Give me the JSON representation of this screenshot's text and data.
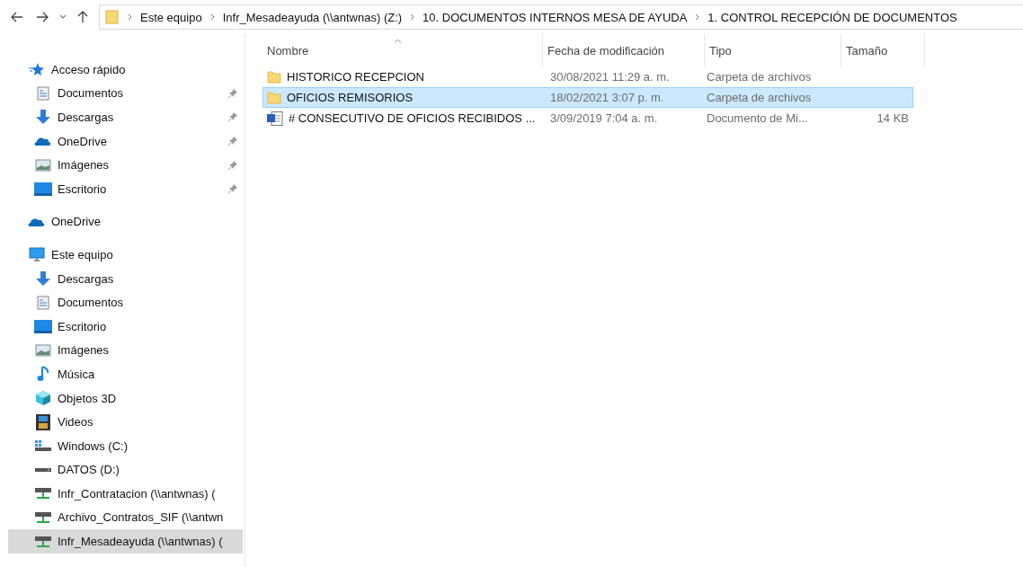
{
  "address_bar": {
    "crumbs": [
      "Este equipo",
      "Infr_Mesadeayuda (\\\\antwnas) (Z:)",
      "10. DOCUMENTOS INTERNOS MESA DE AYUDA",
      "1. CONTROL RECEPCIÓN DE DOCUMENTOS"
    ]
  },
  "sidebar": {
    "groups": [
      {
        "label": "Acceso rápido",
        "kind": "star",
        "selected": false,
        "children": [
          {
            "label": "Documentos",
            "kind": "documents",
            "pinned": true,
            "selected": false
          },
          {
            "label": "Descargas",
            "kind": "download",
            "pinned": true,
            "selected": false
          },
          {
            "label": "OneDrive",
            "kind": "cloud",
            "pinned": true,
            "selected": false
          },
          {
            "label": "Imágenes",
            "kind": "pictures",
            "pinned": true,
            "selected": false
          },
          {
            "label": "Escritorio",
            "kind": "desktop",
            "pinned": true,
            "selected": false
          }
        ]
      },
      {
        "label": "OneDrive",
        "kind": "cloud",
        "selected": false
      },
      {
        "label": "Este equipo",
        "kind": "pc",
        "selected": false,
        "children": [
          {
            "label": "Descargas",
            "kind": "download",
            "pinned": false,
            "selected": false
          },
          {
            "label": "Documentos",
            "kind": "documents",
            "pinned": false,
            "selected": false
          },
          {
            "label": "Escritorio",
            "kind": "desktop",
            "pinned": false,
            "selected": false
          },
          {
            "label": "Imágenes",
            "kind": "pictures",
            "pinned": false,
            "selected": false
          },
          {
            "label": "Música",
            "kind": "music",
            "pinned": false,
            "selected": false
          },
          {
            "label": "Objetos 3D",
            "kind": "cube",
            "pinned": false,
            "selected": false
          },
          {
            "label": "Videos",
            "kind": "video",
            "pinned": false,
            "selected": false
          },
          {
            "label": "Windows (C:)",
            "kind": "windows-drive",
            "pinned": false,
            "selected": false
          },
          {
            "label": "DATOS (D:)",
            "kind": "drive",
            "pinned": false,
            "selected": false
          },
          {
            "label": "Infr_Contratacion (\\\\antwnas) (",
            "kind": "network-drive",
            "pinned": false,
            "selected": false
          },
          {
            "label": "Archivo_Contratos_SIF (\\\\antwn",
            "kind": "network-drive",
            "pinned": false,
            "selected": false
          },
          {
            "label": "Infr_Mesadeayuda (\\\\antwnas) (",
            "kind": "network-drive",
            "pinned": false,
            "selected": true
          }
        ]
      }
    ]
  },
  "table": {
    "columns": [
      "Nombre",
      "Fecha de modificación",
      "Tipo",
      "Tamaño"
    ],
    "rows": [
      {
        "kind": "folder",
        "name": "HISTORICO RECEPCION",
        "date": "30/08/2021 11:29 a. m.",
        "type": "Carpeta de archivos",
        "selected": false
      },
      {
        "kind": "folder",
        "name": "OFICIOS REMISORIOS",
        "date": "18/02/2021 3:07 p. m.",
        "type": "Carpeta de archivos",
        "selected": true
      },
      {
        "kind": "word",
        "name": "# CONSECUTIVO DE OFICIOS RECIBIDOS ...",
        "date": "3/09/2019 7:04 a. m.",
        "type": "Documento de Mi...",
        "size": "14 KB",
        "selected": false
      }
    ]
  }
}
